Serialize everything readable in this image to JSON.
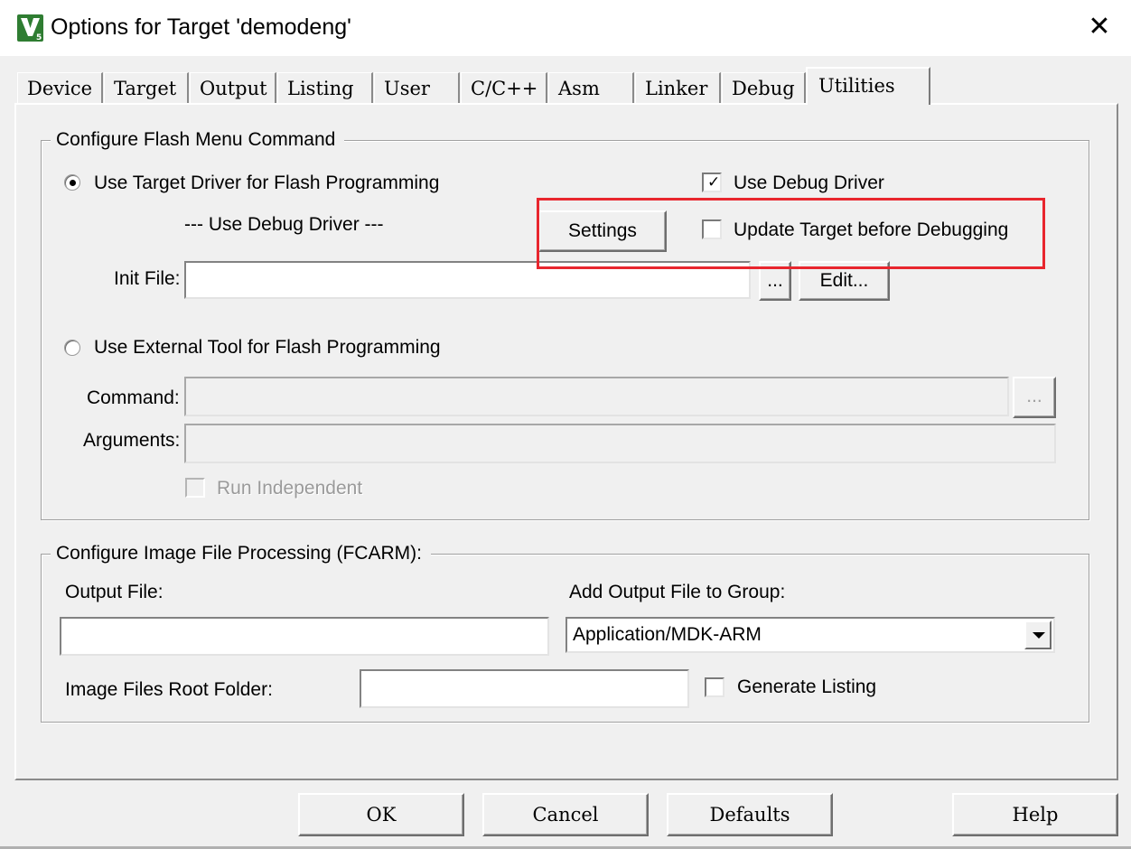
{
  "window": {
    "title": "Options for Target 'demodeng'",
    "app_icon": "keil-uvision-5-icon",
    "close_glyph": "✕"
  },
  "tabs": [
    {
      "label": "Device"
    },
    {
      "label": "Target"
    },
    {
      "label": "Output"
    },
    {
      "label": "Listing"
    },
    {
      "label": "User"
    },
    {
      "label": "C/C++"
    },
    {
      "label": "Asm"
    },
    {
      "label": "Linker"
    },
    {
      "label": "Debug"
    },
    {
      "label": "Utilities",
      "selected": true
    }
  ],
  "flash_group": {
    "title": "Configure Flash Menu Command",
    "use_target_driver": {
      "label": "Use Target Driver for Flash Programming",
      "selected": true
    },
    "driver_name": "--- Use Debug Driver ---",
    "settings_button": "Settings",
    "use_debug_driver": {
      "label": "Use Debug Driver",
      "checked": true
    },
    "update_target": {
      "label": "Update Target before Debugging",
      "checked": false
    },
    "init_file": {
      "label": "Init File:",
      "value": "",
      "browse_label": "...",
      "edit_label": "Edit..."
    },
    "use_external_tool": {
      "label": "Use External Tool for Flash Programming",
      "selected": false
    },
    "command": {
      "label": "Command:",
      "value": "",
      "browse_label": "..."
    },
    "arguments": {
      "label": "Arguments:",
      "value": ""
    },
    "run_independent": {
      "label": "Run Independent",
      "checked": false,
      "disabled": true
    }
  },
  "image_group": {
    "title": "Configure Image File Processing (FCARM):",
    "output_file": {
      "label": "Output File:",
      "value": ""
    },
    "add_output_to_group": {
      "label": "Add Output File  to Group:",
      "selected": "Application/MDK-ARM"
    },
    "image_root_folder": {
      "label": "Image Files Root Folder:",
      "value": ""
    },
    "generate_listing": {
      "label": "Generate Listing",
      "checked": false
    }
  },
  "buttons": {
    "ok": "OK",
    "cancel": "Cancel",
    "defaults": "Defaults",
    "help": "Help"
  },
  "colors": {
    "dialog_bg": "#f0f0f0",
    "highlight_annotation": "#e8262e",
    "icon_green": "#2f7d32"
  }
}
